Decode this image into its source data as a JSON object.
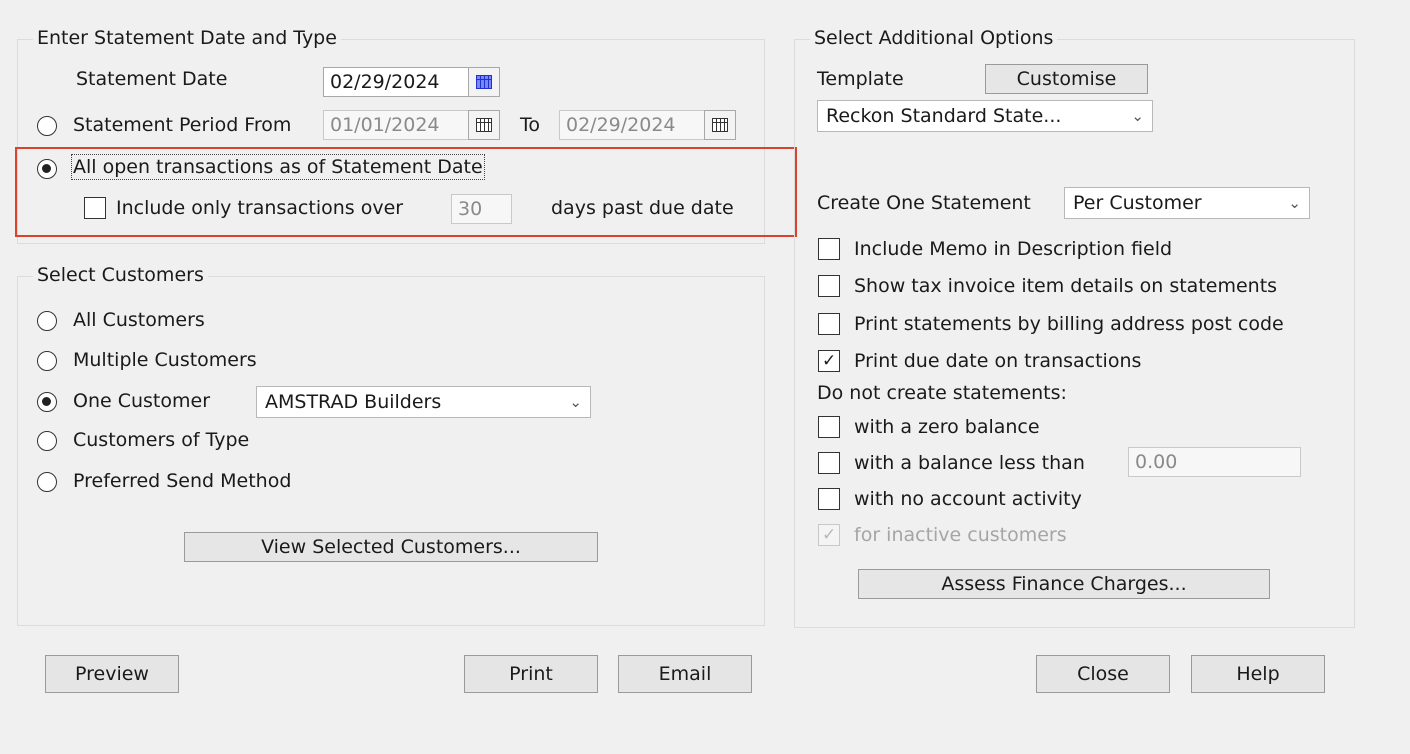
{
  "statement_date_group": {
    "title": "Enter Statement Date and Type",
    "statement_date_label": "Statement Date",
    "statement_date_value": "02/29/2024",
    "statement_period_label": "Statement Period From",
    "period_from_value": "01/01/2024",
    "to_label": "To",
    "period_to_value": "02/29/2024",
    "all_open_label": "All open transactions as of Statement Date",
    "include_only_label": "Include only transactions over",
    "days_value": "30",
    "days_suffix": "days past due date"
  },
  "customers_group": {
    "title": "Select Customers",
    "all_customers": "All Customers",
    "multiple_customers": "Multiple Customers",
    "one_customer": "One Customer",
    "one_customer_value": "AMSTRAD Builders",
    "customers_of_type": "Customers of Type",
    "preferred_send_method": "Preferred Send Method",
    "view_selected_button": "View Selected Customers..."
  },
  "options_group": {
    "title": "Select Additional Options",
    "template_label": "Template",
    "customise_button": "Customise",
    "template_value": "Reckon Standard State...",
    "create_one_label": "Create One Statement",
    "create_one_value": "Per Customer",
    "include_memo": "Include Memo in Description field",
    "show_tax_invoice": "Show tax invoice item details on statements",
    "print_by_postcode": "Print statements by billing address post code",
    "print_due_date": "Print due date on transactions",
    "do_not_create_label": "Do not create statements:",
    "zero_balance": "with a zero balance",
    "balance_less_than": "with a balance less than",
    "balance_value": "0.00",
    "no_account_activity": "with no account activity",
    "inactive_customers": "for inactive customers",
    "assess_finance_button": "Assess Finance Charges..."
  },
  "bottom_buttons": {
    "preview": "Preview",
    "print": "Print",
    "email": "Email",
    "close": "Close",
    "help": "Help"
  },
  "accent_colors": {
    "highlight_border": "#d9432b",
    "calendar_active": "#1f33c9"
  }
}
